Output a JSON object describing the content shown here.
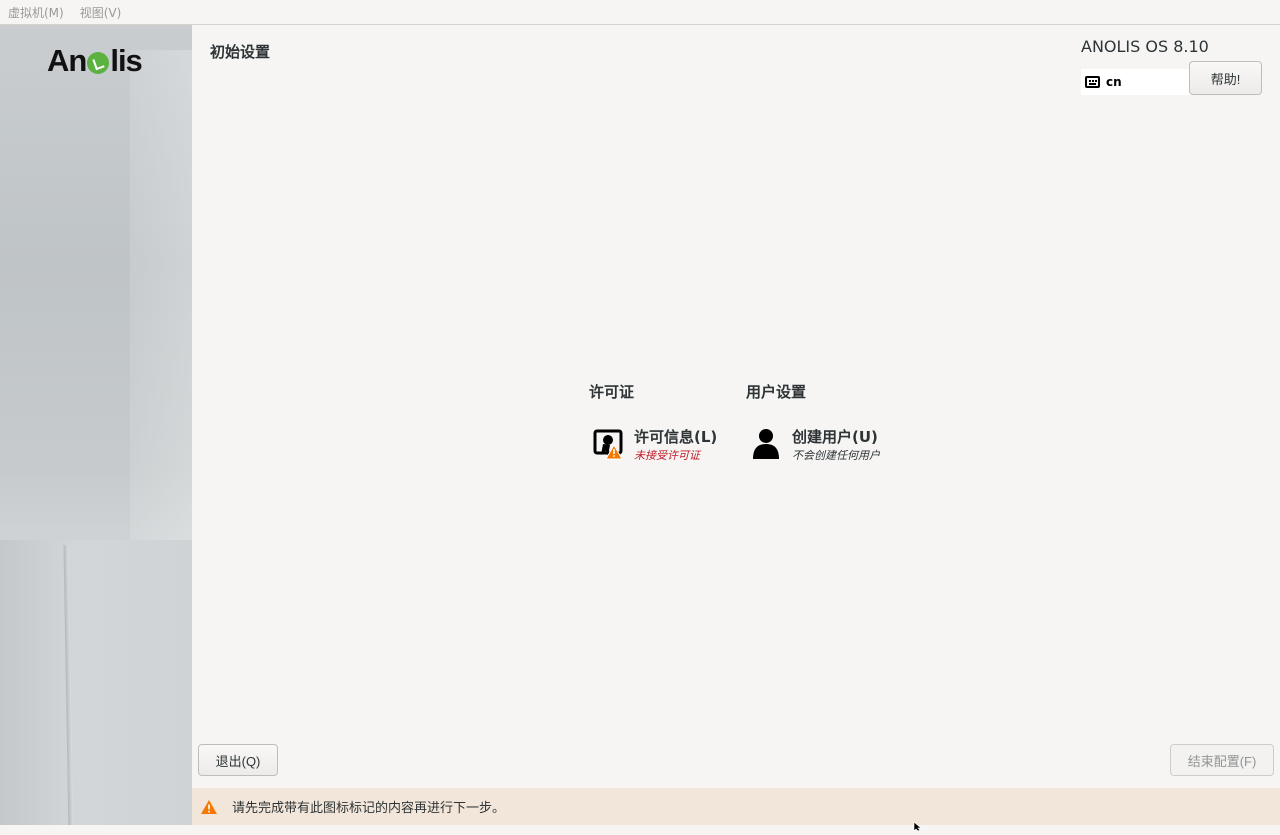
{
  "menubar": {
    "items": [
      {
        "label": "虚拟机(M)"
      },
      {
        "label": "视图(V)"
      }
    ]
  },
  "sidebar": {
    "logo_text_left": "An",
    "logo_text_right": "lis"
  },
  "header": {
    "page_title": "初始设置",
    "os_title": "ANOLIS OS 8.10",
    "keyboard_layout": "cn",
    "help_label": "帮助!"
  },
  "categories": [
    {
      "title": "许可证",
      "spoke": {
        "label": "许可信息(L)",
        "status": "未接受许可证",
        "icon": "license-warning-icon"
      }
    },
    {
      "title": "用户设置",
      "spoke": {
        "label": "创建用户(U)",
        "status": "不会创建任何用户",
        "icon": "user-icon"
      }
    }
  ],
  "footer": {
    "quit_label": "退出(Q)",
    "finish_label": "结束配置(F)",
    "warning_text": "请先完成带有此图标标记的内容再进行下一步。"
  },
  "colors": {
    "warning_red": "#c01c28",
    "warning_orange": "#f57900",
    "warnbar_bg": "#f2e6da",
    "logo_green": "#5bb240"
  }
}
